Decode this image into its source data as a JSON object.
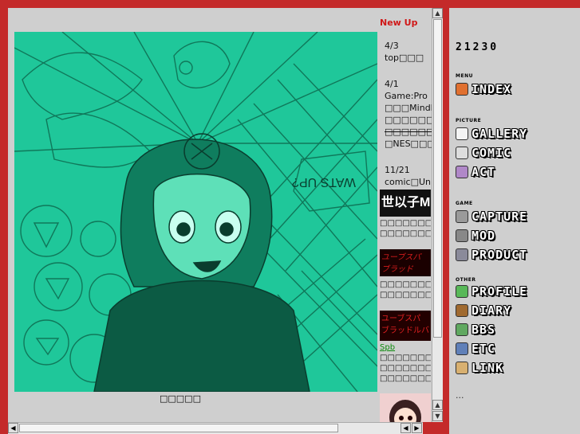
{
  "main": {
    "caption": "□□□□□",
    "art_text": "WATS UP?"
  },
  "newup": {
    "title": "New Up",
    "entries": [
      {
        "date": "4/3",
        "lines": [
          "top□□□"
        ]
      },
      {
        "date": "4/1",
        "lines": [
          "Game:Pro",
          "□□□MindBr",
          "□□□□□□□",
          "□□□□□□□□",
          "□NES□□□□"
        ]
      },
      {
        "date": "11/21",
        "lines": [
          "comic□Un"
        ]
      }
    ],
    "thumbs": [
      {
        "label": "世以子Mind",
        "caption": [
          "□□□□□□□□",
          "□□□□□□□□□"
        ]
      },
      {
        "label": "ユーブスパ ブラッド",
        "caption": [
          "□□□□□□□B",
          "□□□□□□□□"
        ]
      },
      {
        "label": "ユーブスパ ブラッドルバー",
        "link": "Spb",
        "caption": [
          "□□□□□□□B",
          "□□□□□□□□",
          "□□□□□□□□"
        ]
      }
    ]
  },
  "sidebar": {
    "counter": "21230",
    "sections": [
      {
        "label": "MENU",
        "items": [
          {
            "label": "INDEX",
            "icon": "house-icon"
          }
        ]
      },
      {
        "label": "PICTURE",
        "items": [
          {
            "label": "GALLERY",
            "icon": "palette-icon"
          },
          {
            "label": "COMIC",
            "icon": "page-icon"
          },
          {
            "label": "ACT",
            "icon": "character-icon"
          }
        ]
      },
      {
        "label": "GAME",
        "items": [
          {
            "label": "CAPTURE",
            "icon": "wrench-icon"
          },
          {
            "label": "MOD",
            "icon": "gun-icon"
          },
          {
            "label": "PRODUCT",
            "icon": "tool-icon"
          }
        ]
      },
      {
        "label": "OTHER",
        "items": [
          {
            "label": "PROFILE",
            "icon": "face-icon"
          },
          {
            "label": "DIARY",
            "icon": "book-icon"
          },
          {
            "label": "BBS",
            "icon": "board-icon"
          },
          {
            "label": "ETC",
            "icon": "bird-icon"
          },
          {
            "label": "LINK",
            "icon": "signpost-icon"
          }
        ]
      }
    ],
    "ellipsis": "..."
  },
  "colors": {
    "frame": "#c42a2a",
    "panel": "#cfcfcf",
    "art_bg": "#1fc79a",
    "art_line": "#0b5e45",
    "newup": "#d01818"
  }
}
